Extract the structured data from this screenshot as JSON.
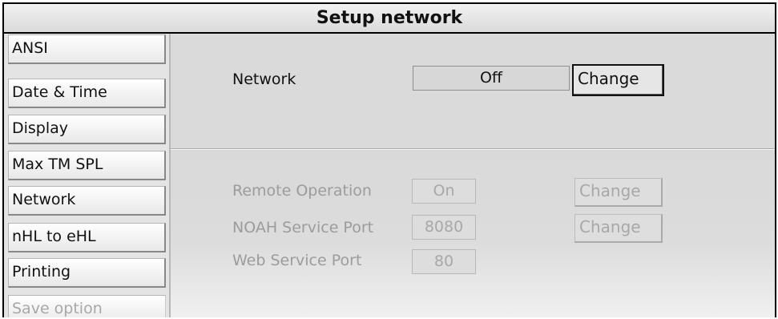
{
  "window": {
    "title": "Setup network"
  },
  "sidebar": {
    "items": [
      {
        "label": "ANSI",
        "enabled": true
      },
      {
        "label": "Date & Time",
        "enabled": true
      },
      {
        "label": "Display",
        "enabled": true
      },
      {
        "label": "Max TM SPL",
        "enabled": true
      },
      {
        "label": "Network",
        "enabled": true
      },
      {
        "label": "nHL to eHL",
        "enabled": true
      },
      {
        "label": "Printing",
        "enabled": true
      },
      {
        "label": "Save option",
        "enabled": false
      }
    ]
  },
  "network": {
    "label": "Network",
    "value": "Off",
    "change_label": "Change"
  },
  "remote_operation": {
    "label": "Remote Operation",
    "value": "On",
    "change_label": "Change"
  },
  "noah_service_port": {
    "label": "NOAH Service Port",
    "value": "8080",
    "change_label": "Change"
  },
  "web_service_port": {
    "label": "Web Service Port",
    "value": "80"
  }
}
